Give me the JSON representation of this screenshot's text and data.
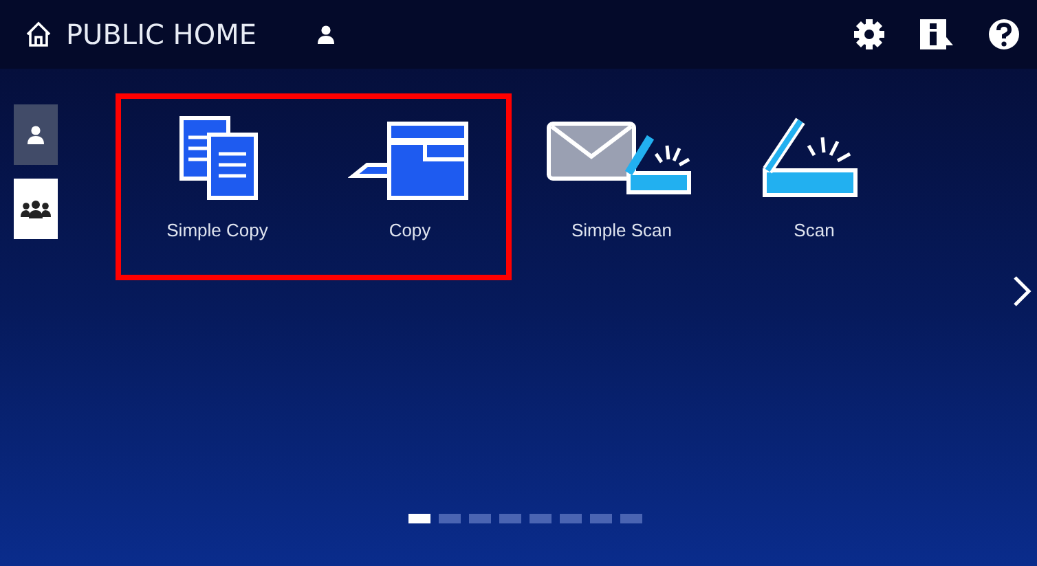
{
  "header": {
    "title": "PUBLIC HOME"
  },
  "side_tabs": [
    {
      "kind": "user",
      "selected": true
    },
    {
      "kind": "group",
      "selected": false
    }
  ],
  "apps": [
    {
      "kind": "simple-copy",
      "label": "Simple Copy",
      "highlighted": true
    },
    {
      "kind": "copy",
      "label": "Copy",
      "highlighted": true
    },
    {
      "kind": "simple-scan",
      "label": "Simple Scan",
      "highlighted": false
    },
    {
      "kind": "scan",
      "label": "Scan",
      "highlighted": false
    }
  ],
  "pager": [
    {
      "selected": true
    },
    {
      "selected": false
    },
    {
      "selected": false
    },
    {
      "selected": false
    },
    {
      "selected": false
    },
    {
      "selected": false
    },
    {
      "selected": false
    },
    {
      "selected": false
    }
  ]
}
